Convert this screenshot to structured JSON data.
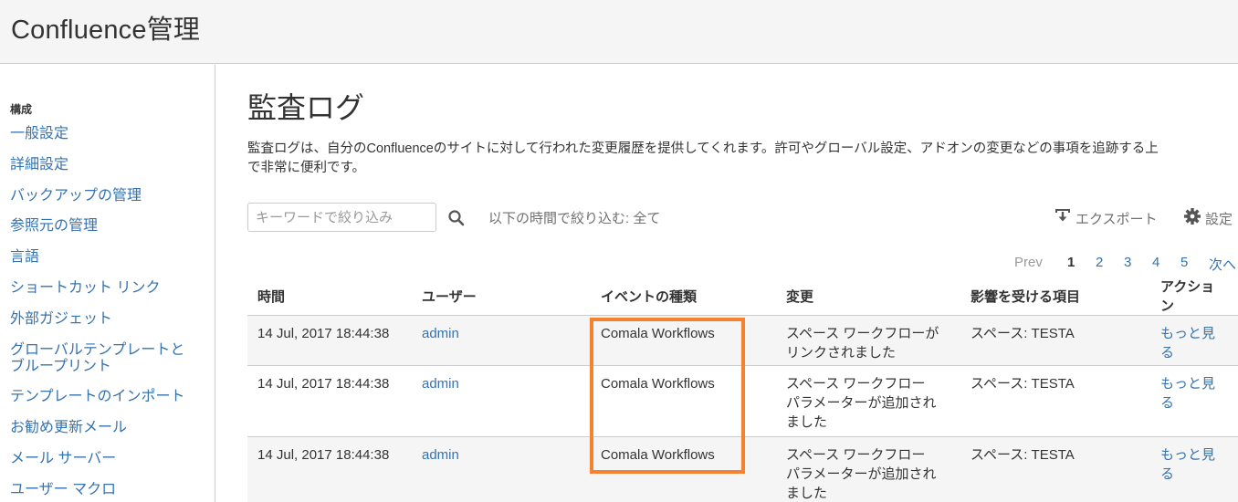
{
  "header": {
    "title": "Confluence管理"
  },
  "sidebar": {
    "section_title": "構成",
    "items": [
      {
        "label": "一般設定"
      },
      {
        "label": "詳細設定"
      },
      {
        "label": "バックアップの管理"
      },
      {
        "label": "参照元の管理"
      },
      {
        "label": "言語"
      },
      {
        "label": "ショートカット リンク"
      },
      {
        "label": "外部ガジェット"
      },
      {
        "label": "グローバルテンプレートと\nブループリント"
      },
      {
        "label": "テンプレートのインポート"
      },
      {
        "label": "お勧め更新メール"
      },
      {
        "label": "メール サーバー"
      },
      {
        "label": "ユーザー マクロ"
      }
    ]
  },
  "main": {
    "title": "監査ログ",
    "description_line1": "監査ログは、自分のConfluenceのサイトに対して行われた変更履歴を提供してくれます。許可やグローバル設定、アドオンの変更などの事項を追跡する上",
    "description_line2": "で非常に便利です。",
    "search": {
      "placeholder": "キーワードで絞り込み",
      "value": ""
    },
    "time_filter": "以下の時間で絞り込む: 全て",
    "export_label": "エクスポート",
    "settings_label": "設定",
    "pagination": {
      "prev": "Prev",
      "pages": [
        "1",
        "2",
        "3",
        "4",
        "5"
      ],
      "current": "1",
      "next": "次へ"
    },
    "table": {
      "columns": [
        "時間",
        "ユーザー",
        "イベントの種類",
        "変更",
        "影響を受ける項目",
        "アクション"
      ],
      "rows": [
        {
          "time": "14 Jul, 2017 18:44:38",
          "user": "admin",
          "event": "Comala Workflows",
          "change": "スペース ワークフローが\nリンクされました",
          "affected": "スペース: TESTA",
          "action": "もっと見る"
        },
        {
          "time": "14 Jul, 2017 18:44:38",
          "user": "admin",
          "event": "Comala Workflows",
          "change": "スペース ワークフロー\nパラメーターが追加され\nました",
          "affected": "スペース: TESTA",
          "action": "もっと見る"
        },
        {
          "time": "14 Jul, 2017 18:44:38",
          "user": "admin",
          "event": "Comala Workflows",
          "change": "スペース ワークフロー\nパラメーターが追加され\nました",
          "affected": "スペース: TESTA",
          "action": "もっと見る"
        }
      ]
    }
  },
  "colors": {
    "link": "#3572b0",
    "highlight": "#f5822f",
    "header_bg": "#f5f5f5"
  },
  "icons": [
    "search-icon",
    "export-icon",
    "gear-icon"
  ]
}
